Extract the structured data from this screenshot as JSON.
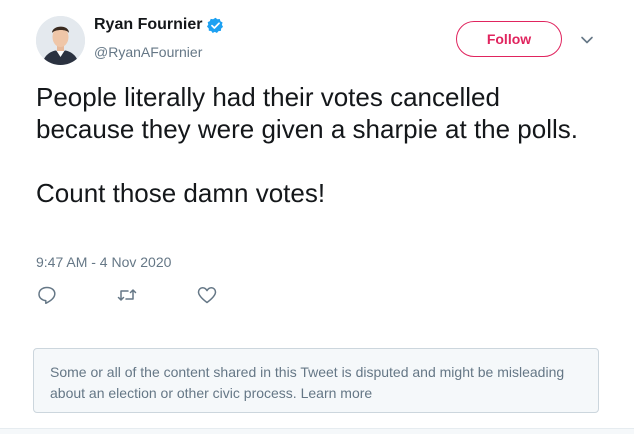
{
  "author": {
    "display_name": "Ryan Fournier",
    "handle": "@RyanAFournier"
  },
  "follow_button": {
    "label": "Follow"
  },
  "tweet": {
    "text": "People literally had their votes cancelled because they were given a sharpie at the polls.\n\nCount those damn votes!",
    "timestamp": "9:47 AM - 4 Nov 2020"
  },
  "actions": {
    "icons": [
      "reply-icon",
      "retweet-icon",
      "like-icon"
    ]
  },
  "notice": {
    "text": "Some or all of the content shared in this Tweet is disputed and might be misleading about an election or other civic process.",
    "link_label": "Learn more"
  },
  "colors": {
    "accent": "#e0245e",
    "verified": "#1da1f2",
    "secondary_text": "#657786",
    "notice_bg": "#f5f8fa"
  }
}
